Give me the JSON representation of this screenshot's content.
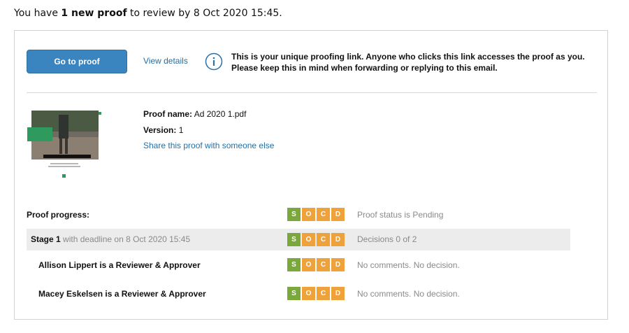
{
  "intro": {
    "prefix": "You have ",
    "highlight": "1 new proof",
    "suffix": " to review by 8 Oct 2020 15:45."
  },
  "actions": {
    "go_to_proof": "Go to proof",
    "view_details": "View details"
  },
  "info": {
    "icon": "info-icon",
    "line1": "This is your unique proofing link. Anyone who clicks this link accesses the proof as you.",
    "line2": "Please keep this in mind when forwarding or replying to this email."
  },
  "proof": {
    "name_label": "Proof name:",
    "name_value": "Ad 2020 1.pdf",
    "version_label": "Version:",
    "version_value": "1",
    "share_link": "Share this proof with someone else"
  },
  "colors": {
    "s": "#7aa83b",
    "o": "#f0a23a",
    "c": "#f0a23a",
    "d": "#f0a23a",
    "link": "#1f6fa8",
    "button": "#3a84bf"
  },
  "progress": {
    "label": "Proof progress:",
    "badges": [
      "S",
      "O",
      "C",
      "D"
    ],
    "status": "Proof status is Pending"
  },
  "stage": {
    "title": "Stage 1",
    "deadline": " with deadline on 8 Oct 2020 15:45",
    "badges": [
      "S",
      "O",
      "C",
      "D"
    ],
    "status": "Decisions 0 of 2"
  },
  "reviewers": [
    {
      "label": "Allison Lippert is a Reviewer & Approver",
      "badges": [
        "S",
        "O",
        "C",
        "D"
      ],
      "status": "No comments. No decision."
    },
    {
      "label": "Macey Eskelsen is a Reviewer & Approver",
      "badges": [
        "S",
        "O",
        "C",
        "D"
      ],
      "status": "No comments. No decision."
    }
  ]
}
